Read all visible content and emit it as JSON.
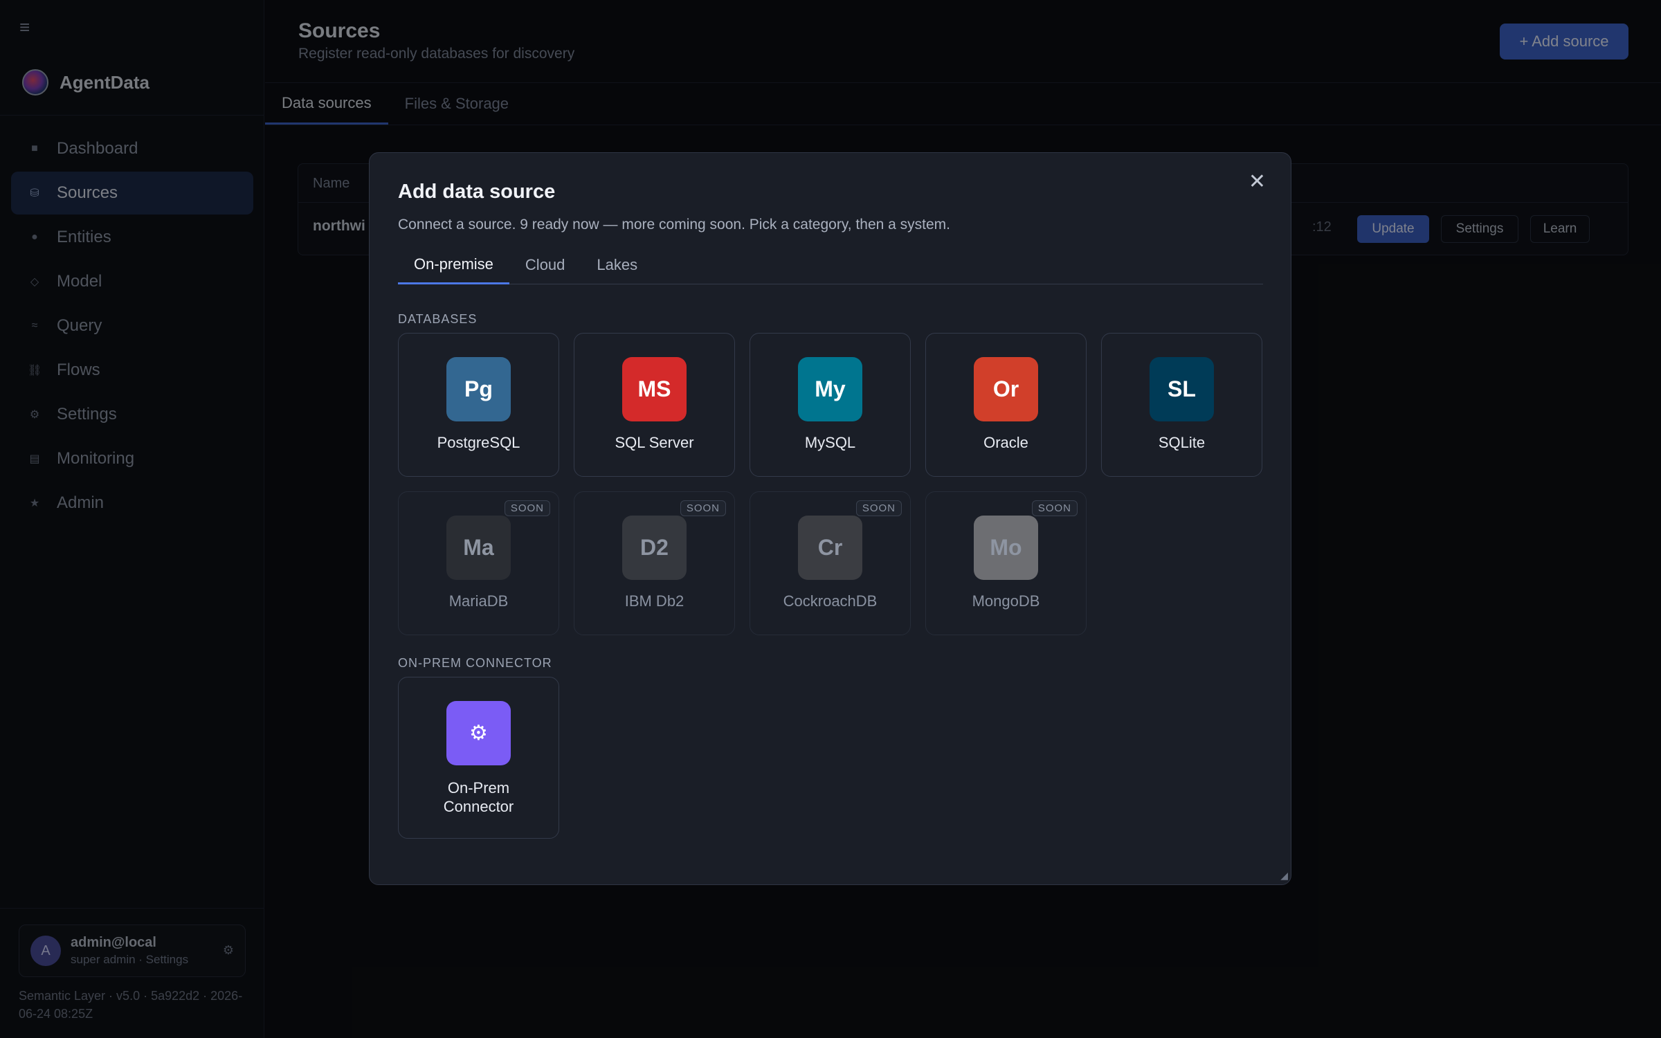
{
  "sidebar": {
    "brand": "AgentData",
    "items": [
      {
        "label": "Dashboard",
        "icon": "square-icon",
        "glyph": "■"
      },
      {
        "label": "Sources",
        "icon": "database-icon",
        "glyph": "⛁"
      },
      {
        "label": "Entities",
        "icon": "circle-icon",
        "glyph": "●"
      },
      {
        "label": "Model",
        "icon": "diamond-icon",
        "glyph": "◇"
      },
      {
        "label": "Query",
        "icon": "approx-icon",
        "glyph": "≈"
      },
      {
        "label": "Flows",
        "icon": "link-icon",
        "glyph": "⛓"
      },
      {
        "label": "Settings",
        "icon": "gear-icon",
        "glyph": "⚙"
      },
      {
        "label": "Monitoring",
        "icon": "chart-icon",
        "glyph": "▤"
      },
      {
        "label": "Admin",
        "icon": "star-icon",
        "glyph": "★"
      }
    ],
    "active_item": "Sources",
    "user": {
      "initial": "A",
      "name": "admin@local",
      "role": "super admin · Settings"
    },
    "version": "Semantic Layer · v5.0 · 5a922d2 · 2026-06-24 08:25Z"
  },
  "header": {
    "title": "Sources",
    "subtitle": "Register read-only databases for discovery",
    "add_button": "+ Add source"
  },
  "tabs": {
    "data_sources": "Data sources",
    "files_storage": "Files & Storage"
  },
  "table": {
    "header_name": "Name",
    "row": {
      "name": "northwi",
      "time": ":12",
      "update": "Update",
      "settings": "Settings",
      "learn": "Learn"
    }
  },
  "modal": {
    "title": "Add data source",
    "subtitle": "Connect a source. 9 ready now — more coming soon. Pick a category, then a system.",
    "close": "✕",
    "tabs": [
      "On-premise",
      "Cloud",
      "Lakes"
    ],
    "active_tab": "On-premise",
    "section_databases": "DATABASES",
    "section_connector": "ON-PREM CONNECTOR",
    "soon_label": "SOON",
    "databases": [
      {
        "abbr": "Pg",
        "name": "PostgreSQL",
        "color": "#336791",
        "soon": false
      },
      {
        "abbr": "MS",
        "name": "SQL Server",
        "color": "#d42a2a",
        "soon": false
      },
      {
        "abbr": "My",
        "name": "MySQL",
        "color": "#00758f",
        "soon": false
      },
      {
        "abbr": "Or",
        "name": "Oracle",
        "color": "#d13f2a",
        "soon": false
      },
      {
        "abbr": "SL",
        "name": "SQLite",
        "color": "#003b57",
        "soon": false
      },
      {
        "abbr": "Ma",
        "name": "MariaDB",
        "color": "#2a2d33",
        "soon": true
      },
      {
        "abbr": "D2",
        "name": "IBM Db2",
        "color": "#35383e",
        "soon": true
      },
      {
        "abbr": "Cr",
        "name": "CockroachDB",
        "color": "#3b3d42",
        "soon": true
      },
      {
        "abbr": "Mo",
        "name": "MongoDB",
        "color": "#6d6e72",
        "soon": true
      }
    ],
    "connector": {
      "glyph": "⚙",
      "name_line1": "On-Prem",
      "name_line2": "Connector",
      "color": "#7b5cf5"
    }
  }
}
